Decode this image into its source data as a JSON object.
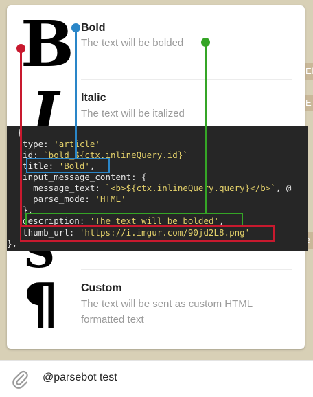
{
  "results": [
    {
      "glyph": "B",
      "title": "Bold",
      "description": "The text will be bolded"
    },
    {
      "glyph": "I",
      "title": "Italic",
      "description": "The text will be italized"
    },
    {
      "glyph": "S",
      "title": "",
      "description": ""
    },
    {
      "glyph": "¶",
      "title": "Custom",
      "description": "The text will be sent as custom HTML formatted text"
    }
  ],
  "code": {
    "line0": "  {",
    "line1_key": "  type: ",
    "line1_val": "'article'",
    "line2_key": "  id: ",
    "line2_val": "`bold_${ctx.inlineQuery.id}`",
    "line3_key": "  title: ",
    "line3_val": "'Bold'",
    "line3_end": ",",
    "line4": "  input_message_content: {",
    "line5_key": "    message_text: ",
    "line5_val": "`<b>${ctx.inlineQuery.query}</b>`",
    "line5_end": ", @",
    "line6_key": "    parse_mode: ",
    "line6_val": "'HTML'",
    "line7": "  },",
    "line8_key": "  description: ",
    "line8_val": "'The text will be bolded'",
    "line8_end": ",",
    "line9_key": "  thumb_url: ",
    "line9_val": "'https://i.imgur.com/90jd2L8.png'",
    "line10": "},"
  },
  "highlight_colors": {
    "blue": "#2a86c8",
    "green": "#35a526",
    "red": "#c8192e"
  },
  "side_chips": [
    "El",
    "E",
    "e"
  ],
  "input": {
    "value": "@parsebot test"
  },
  "icons": {
    "attach": "paperclip-icon"
  }
}
